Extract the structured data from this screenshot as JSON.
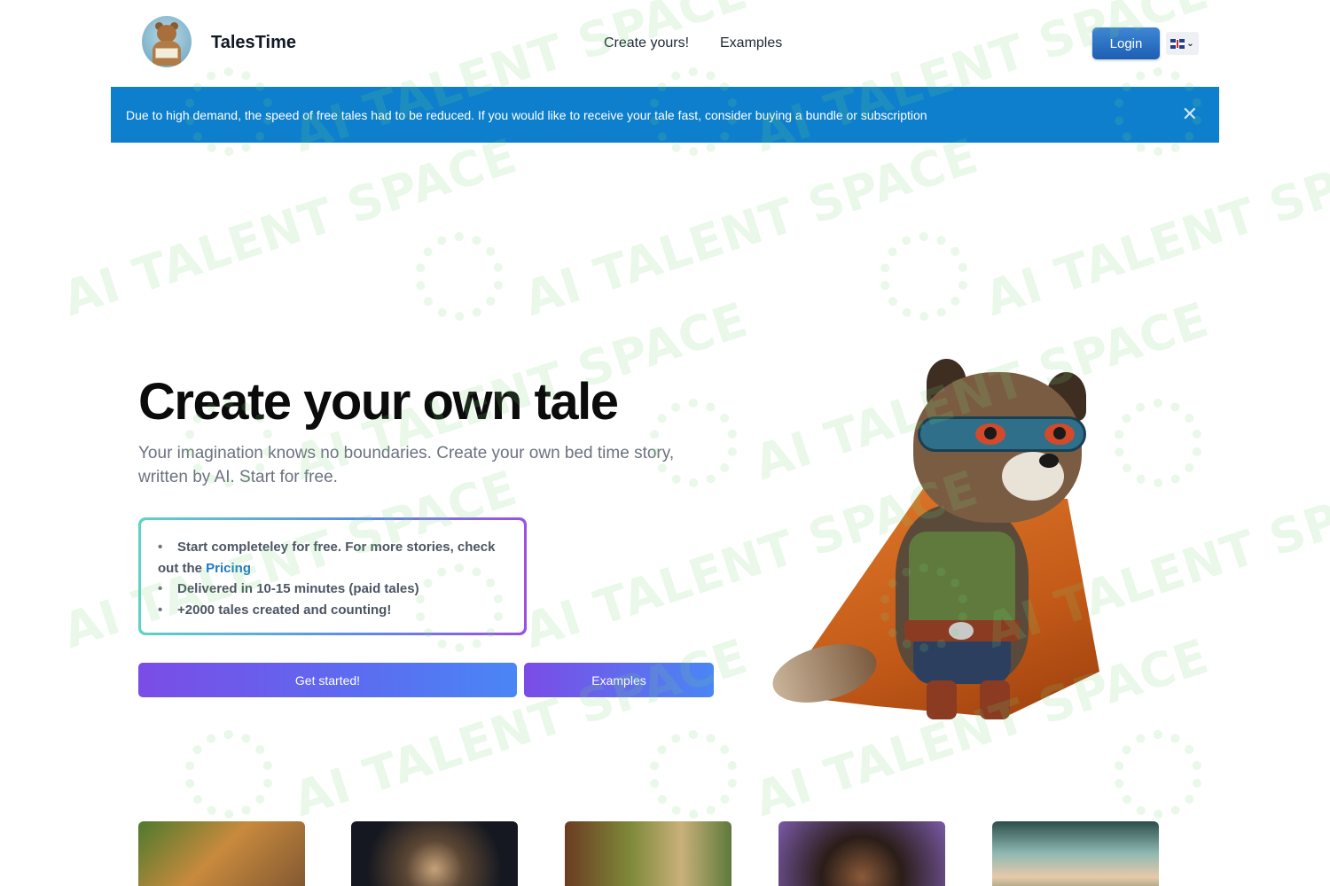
{
  "header": {
    "brand": "TalesTime",
    "nav": [
      "Create yours!",
      "Examples"
    ],
    "login_label": "Login",
    "language_flag": "uk-flag-icon"
  },
  "banner": {
    "text": "Due to high demand, the speed of free tales had to be reduced. If you would like to receive your tale fast, consider buying a bundle or subscription",
    "close_icon": "close-icon",
    "color": "#0d7fcc"
  },
  "hero": {
    "title": "Create your own tale",
    "subtitle": "Your imagination knows no boundaries. Create your own bed time story, written by AI. Start for free.",
    "features": {
      "item1_text": "Start completeley for free. For more stories, check out the ",
      "item1_link": "Pricing",
      "item2": "Delivered in 10-15 minutes (paid tales)",
      "item3": "+2000 tales created and counting!"
    },
    "cta_primary": "Get started!",
    "cta_secondary": "Examples",
    "illustration": "superhero-raccoon-illustration"
  },
  "gallery": {
    "thumbnails": [
      "monkey-explorer",
      "astronaut-bear",
      "forest-street",
      "girl-portrait",
      "city-gate"
    ]
  },
  "watermark": {
    "text": "AI TALENT SPACE"
  },
  "colors": {
    "accent": "#0d7fcc",
    "login": "#1d5fb3",
    "cta_gradient_start": "#7b4ce6",
    "cta_gradient_end": "#4a86f5",
    "link": "#1d78c7"
  }
}
